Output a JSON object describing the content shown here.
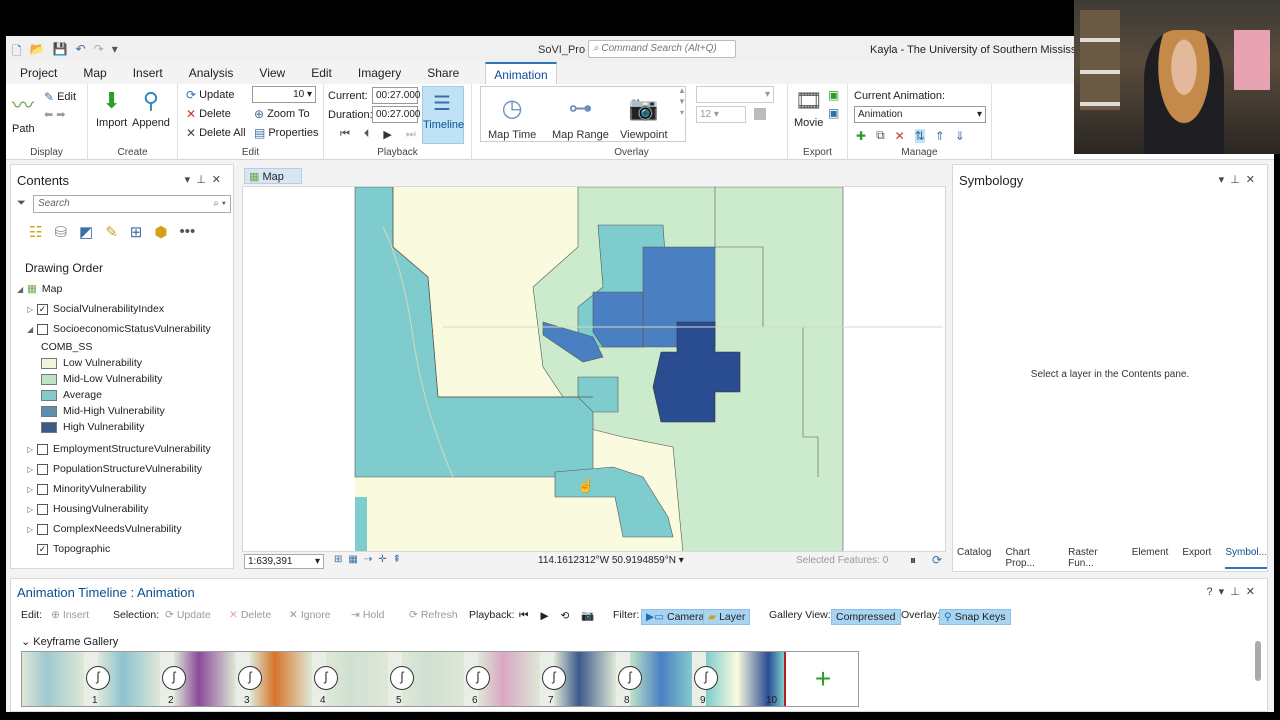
{
  "titlebar": {
    "app_title": "SoVI_Pro",
    "command_search_placeholder": "Command Search (Alt+Q)",
    "user": "Kayla - The University of Southern Mississippi"
  },
  "tabs": [
    "Project",
    "Map",
    "Insert",
    "Analysis",
    "View",
    "Edit",
    "Imagery",
    "Share",
    "Animation"
  ],
  "ribbon": {
    "display": {
      "label": "Display",
      "path": "Path",
      "edit": "Edit"
    },
    "create": {
      "label": "Create",
      "import": "Import",
      "append": "Append"
    },
    "edit": {
      "label": "Edit",
      "update": "Update",
      "delete": "Delete",
      "delete_all": "Delete All",
      "count": "10",
      "zoom_to": "Zoom To",
      "properties": "Properties"
    },
    "playback": {
      "label": "Playback",
      "current_label": "Current:",
      "current_value": "00:27.000",
      "duration_label": "Duration:",
      "duration_value": "00:27.000",
      "timeline": "Timeline"
    },
    "overlay": {
      "label": "Overlay",
      "map_time": "Map Time",
      "map_range": "Map Range",
      "viewpoint": "Viewpoint",
      "font_size": "12"
    },
    "export": {
      "label": "Export",
      "movie": "Movie"
    },
    "manage": {
      "label": "Manage",
      "current_animation_label": "Current Animation:",
      "current_animation_value": "Animation"
    }
  },
  "contents": {
    "title": "Contents",
    "search_placeholder": "Search",
    "drawing_order": "Drawing Order",
    "map": "Map",
    "layers": [
      {
        "name": "SocialVulnerabilityIndex",
        "checked": true
      },
      {
        "name": "SocioeconomicStatusVulnerability",
        "checked": false
      }
    ],
    "field": "COMB_SS",
    "legend": [
      {
        "label": "Low Vulnerability",
        "color": "#eef5d8"
      },
      {
        "label": "Mid-Low Vulnerability",
        "color": "#bfe3c9"
      },
      {
        "label": "Average",
        "color": "#85c8cc"
      },
      {
        "label": "Mid-High Vulnerability",
        "color": "#5a8fae"
      },
      {
        "label": "High Vulnerability",
        "color": "#3b5a8a"
      }
    ],
    "other_layers": [
      {
        "name": "EmploymentStructureVulnerability",
        "checked": false
      },
      {
        "name": "PopulationStructureVulnerability",
        "checked": false
      },
      {
        "name": "MinorityVulnerability",
        "checked": false
      },
      {
        "name": "HousingVulnerability",
        "checked": false
      },
      {
        "name": "ComplexNeedsVulnerability",
        "checked": false
      },
      {
        "name": "Topographic",
        "checked": true
      }
    ]
  },
  "map": {
    "tab": "Map",
    "scale": "1:639,391",
    "coords": "114.1612312°W 50.9194859°N",
    "selected_features": "Selected Features: 0",
    "colors": {
      "low": "#fafbde",
      "midlow": "#ccebcd",
      "avg": "#7ecccd",
      "midhigh": "#4a80c2",
      "high": "#2a4d92"
    }
  },
  "symbology": {
    "title": "Symbology",
    "message": "Select a layer in the Contents pane.",
    "bottom_tabs": [
      "Catalog",
      "Chart Prop...",
      "Raster Fun...",
      "Element",
      "Export",
      "Symbol..."
    ]
  },
  "timeline": {
    "title": "Animation Timeline : Animation",
    "edit_label": "Edit:",
    "insert": "Insert",
    "selection_label": "Selection:",
    "update": "Update",
    "delete": "Delete",
    "ignore": "Ignore",
    "hold": "Hold",
    "refresh": "Refresh",
    "playback_label": "Playback:",
    "filter_label": "Filter:",
    "camera": "Camera",
    "layer": "Layer",
    "gallery_view_label": "Gallery View:",
    "compressed": "Compressed",
    "overlay_label": "Overlay:",
    "snap_keys": "Snap Keys",
    "keyframe_gallery": "Keyframe Gallery",
    "keyframes": [
      "1",
      "2",
      "3",
      "4",
      "5",
      "6",
      "7",
      "8",
      "9",
      "10"
    ]
  }
}
